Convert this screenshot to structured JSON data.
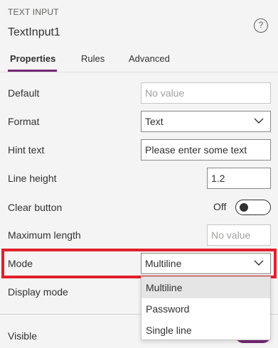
{
  "header": {
    "control_type": "TEXT INPUT",
    "control_name": "TextInput1",
    "help_glyph": "?"
  },
  "tabs": [
    {
      "label": "Properties",
      "active": true
    },
    {
      "label": "Rules",
      "active": false
    },
    {
      "label": "Advanced",
      "active": false
    }
  ],
  "properties": {
    "default": {
      "label": "Default",
      "value": "",
      "placeholder": "No value"
    },
    "format": {
      "label": "Format",
      "value": "Text"
    },
    "hint_text": {
      "label": "Hint text",
      "value": "Please enter some text"
    },
    "line_height": {
      "label": "Line height",
      "value": "1.2"
    },
    "clear_button": {
      "label": "Clear button",
      "state": "Off"
    },
    "maximum_length": {
      "label": "Maximum length",
      "value": "",
      "placeholder": "No value"
    },
    "mode": {
      "label": "Mode",
      "value": "Multiline",
      "options": [
        "Multiline",
        "Password",
        "Single line"
      ]
    },
    "display_mode": {
      "label": "Display mode"
    },
    "visible": {
      "label": "Visible"
    }
  },
  "colors": {
    "accent": "#742774",
    "highlight": "#e0212b"
  }
}
